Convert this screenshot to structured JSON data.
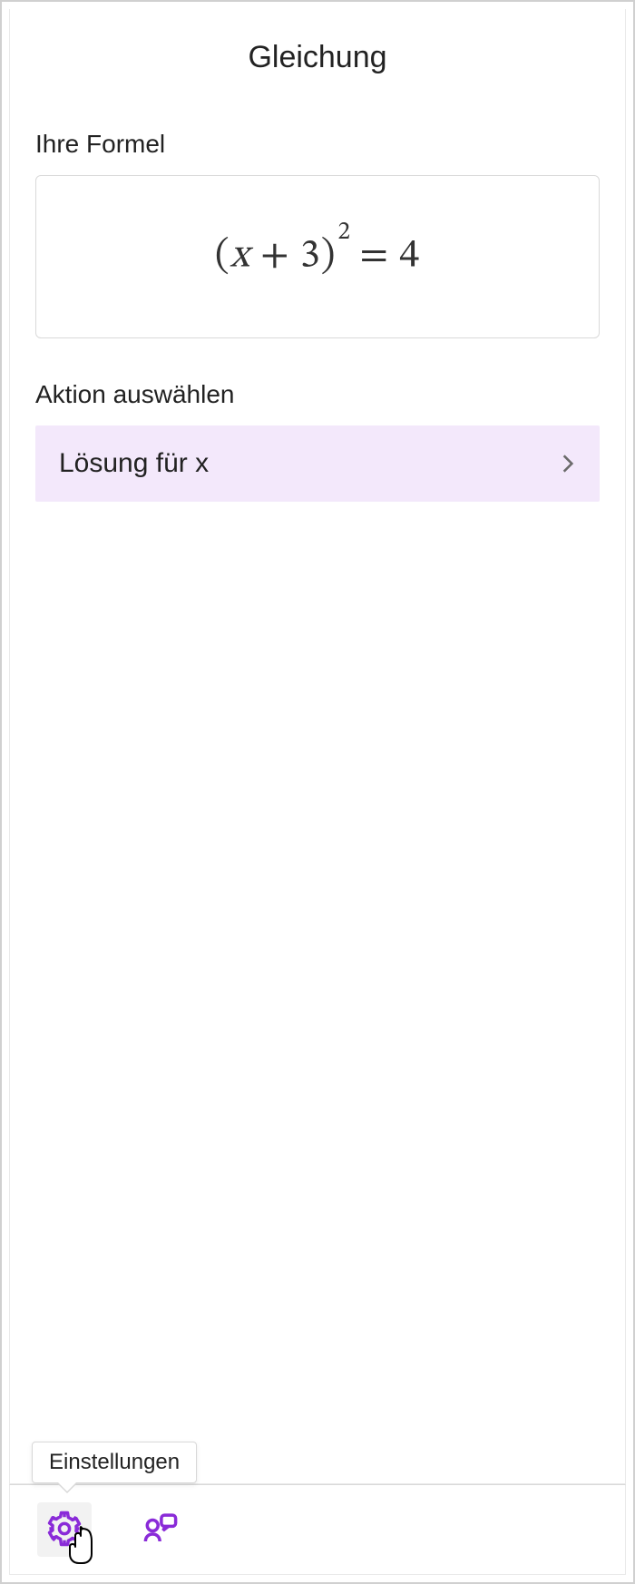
{
  "panel": {
    "title": "Gleichung",
    "formula_label": "Ihre Formel",
    "action_label": "Aktion auswählen"
  },
  "formula": {
    "display": "(x + 3)² = 4",
    "latex": "(x+3)^2 = 4"
  },
  "actions": [
    {
      "label": "Lösung für x"
    }
  ],
  "bottombar": {
    "settings_tooltip": "Einstellungen",
    "icons": {
      "settings": "gear-icon",
      "feedback": "feedback-icon"
    }
  },
  "colors": {
    "accent": "#8a2bd8",
    "action_bg": "#f3e8fb"
  }
}
